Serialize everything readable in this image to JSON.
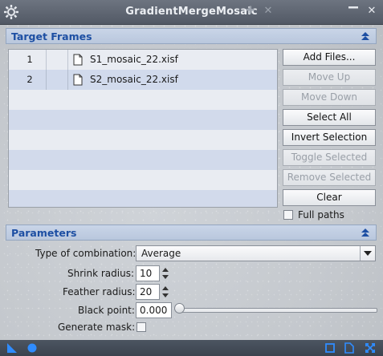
{
  "window": {
    "title": "GradientMergeMosaic"
  },
  "icons": {
    "settings": "gear-icon",
    "pin": "pin-icon",
    "unpin": "unpin-icon",
    "shade": "shade-icon",
    "close": "close-icon"
  },
  "target_frames": {
    "header": "Target Frames",
    "files": [
      {
        "index": "1",
        "name": "S1_mosaic_22.xisf"
      },
      {
        "index": "2",
        "name": "S2_mosaic_22.xisf"
      }
    ],
    "buttons": {
      "add_files": "Add Files...",
      "move_up": "Move Up",
      "move_down": "Move Down",
      "select_all": "Select All",
      "invert_selection": "Invert Selection",
      "toggle_selected": "Toggle Selected",
      "remove_selected": "Remove Selected",
      "clear": "Clear"
    },
    "full_paths_label": "Full paths"
  },
  "parameters": {
    "header": "Parameters",
    "type_of_combination_label": "Type of combination:",
    "type_of_combination_value": "Average",
    "shrink_radius_label": "Shrink radius:",
    "shrink_radius_value": "10",
    "feather_radius_label": "Feather radius:",
    "feather_radius_value": "20",
    "black_point_label": "Black point:",
    "black_point_value": "0.000",
    "generate_mask_label": "Generate mask:"
  },
  "colors": {
    "accent": "#1d4fa3",
    "section_bg": "#c2cfe3",
    "bottom_icons": "#2f8cff"
  }
}
